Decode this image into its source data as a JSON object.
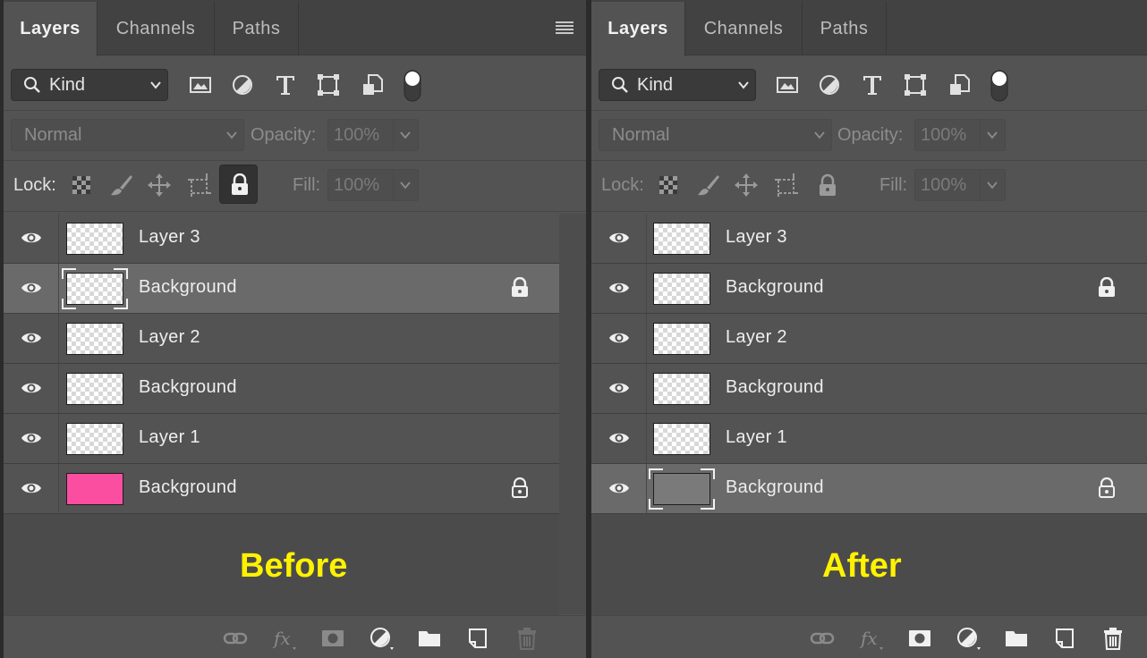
{
  "panels": [
    {
      "tabs": [
        "Layers",
        "Channels",
        "Paths"
      ],
      "filter": {
        "kind_label": "Kind"
      },
      "blend": {
        "mode": "Normal",
        "opacity_label": "Opacity:",
        "opacity_value": "100%"
      },
      "lock": {
        "label": "Lock:",
        "fill_label": "Fill:",
        "fill_value": "100%"
      },
      "layers": [
        {
          "name": "Layer 3",
          "thumb": "transparent",
          "selected": false,
          "locked": false
        },
        {
          "name": "Background",
          "thumb": "transparent",
          "selected": true,
          "locked": true
        },
        {
          "name": "Layer 2",
          "thumb": "transparent",
          "selected": false,
          "locked": false
        },
        {
          "name": "Background",
          "thumb": "transparent",
          "selected": false,
          "locked": false
        },
        {
          "name": "Layer 1",
          "thumb": "transparent",
          "selected": false,
          "locked": false
        },
        {
          "name": "Background",
          "thumb": "pink",
          "selected": false,
          "locked": true
        }
      ],
      "caption": "Before"
    },
    {
      "tabs": [
        "Layers",
        "Channels",
        "Paths"
      ],
      "filter": {
        "kind_label": "Kind"
      },
      "blend": {
        "mode": "Normal",
        "opacity_label": "Opacity:",
        "opacity_value": "100%"
      },
      "lock": {
        "label": "Lock:",
        "fill_label": "Fill:",
        "fill_value": "100%"
      },
      "layers": [
        {
          "name": "Layer 3",
          "thumb": "transparent",
          "selected": false,
          "locked": false
        },
        {
          "name": "Background",
          "thumb": "transparent",
          "selected": false,
          "locked": true
        },
        {
          "name": "Layer 2",
          "thumb": "transparent",
          "selected": false,
          "locked": false
        },
        {
          "name": "Background",
          "thumb": "transparent",
          "selected": false,
          "locked": false
        },
        {
          "name": "Layer 1",
          "thumb": "transparent",
          "selected": false,
          "locked": false
        },
        {
          "name": "Background",
          "thumb": "gray",
          "selected": true,
          "locked": true
        }
      ],
      "caption": "After"
    }
  ],
  "colors": {
    "panel_bg": "#535353",
    "selected_row": "#6a6a6a",
    "caption": "#fff200",
    "pink_fill": "#fb4ea0"
  },
  "icons": {
    "filter": [
      "search-icon",
      "image-filter-icon",
      "adjustment-filter-icon",
      "type-filter-icon",
      "shape-filter-icon",
      "smart-object-filter-icon",
      "filter-toggle-icon"
    ],
    "lock": [
      "lock-transparent-pixels-icon",
      "lock-image-pixels-icon",
      "lock-position-icon",
      "lock-artboard-icon",
      "lock-all-icon"
    ],
    "footer": [
      "link-layers-icon",
      "fx-icon",
      "layer-mask-icon",
      "adjustment-layer-icon",
      "group-folder-icon",
      "new-layer-icon",
      "trash-icon"
    ]
  }
}
